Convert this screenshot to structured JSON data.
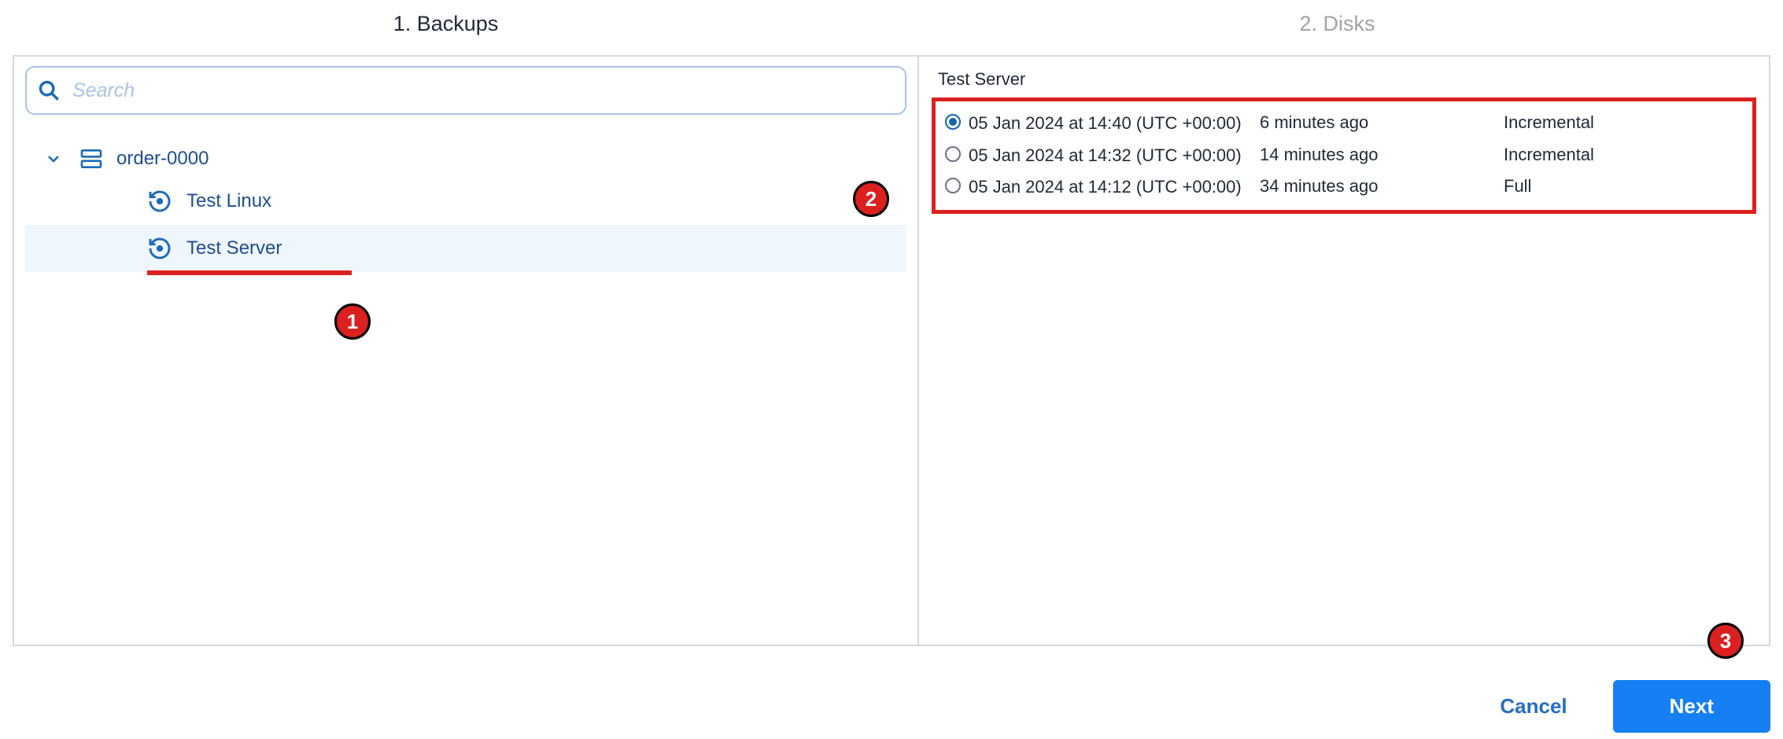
{
  "steps": {
    "step1": "1. Backups",
    "step2": "2. Disks"
  },
  "search": {
    "placeholder": "Search"
  },
  "tree": {
    "group_label": "order-0000",
    "items": [
      {
        "label": "Test Linux"
      },
      {
        "label": "Test Server"
      }
    ]
  },
  "details": {
    "title": "Test Server",
    "backups": [
      {
        "date": "05 Jan 2024 at 14:40 (UTC +00:00)",
        "age": "6 minutes ago",
        "type": "Incremental",
        "selected": true
      },
      {
        "date": "05 Jan 2024 at 14:32 (UTC +00:00)",
        "age": "14 minutes ago",
        "type": "Incremental",
        "selected": false
      },
      {
        "date": "05 Jan 2024 at 14:12 (UTC +00:00)",
        "age": "34 minutes ago",
        "type": "Full",
        "selected": false
      }
    ]
  },
  "footer": {
    "cancel": "Cancel",
    "next": "Next"
  },
  "annotations": {
    "a1": "1",
    "a2": "2",
    "a3": "3"
  }
}
